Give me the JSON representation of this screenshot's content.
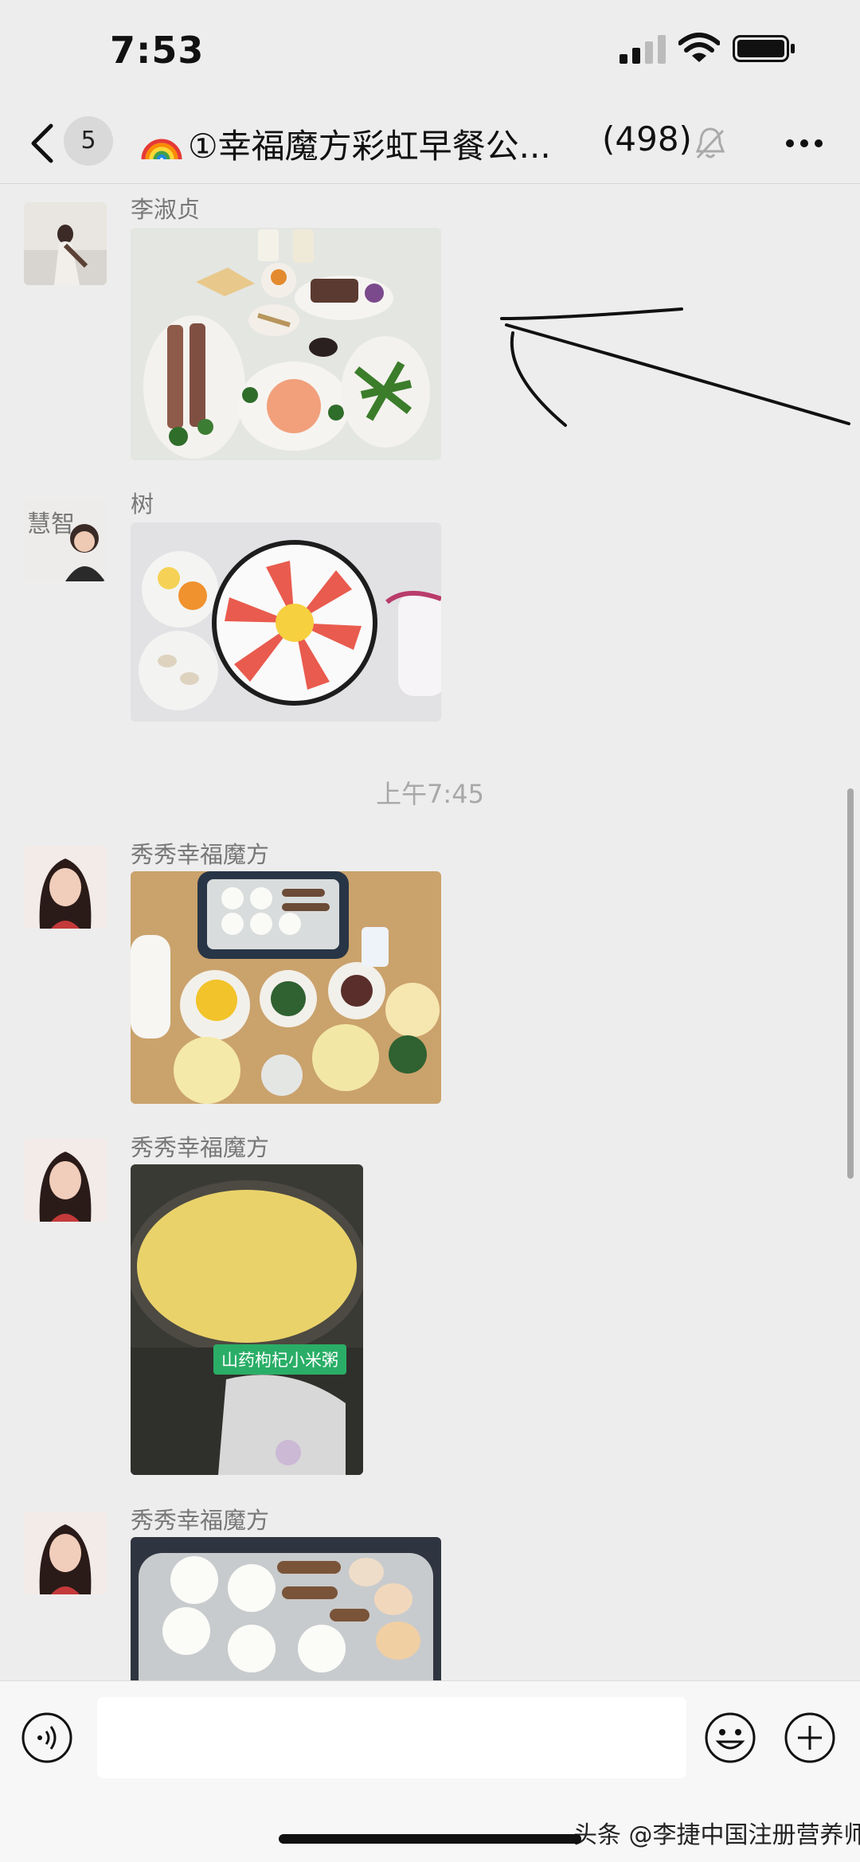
{
  "status_bar": {
    "time": "7:53"
  },
  "header": {
    "unread_count": "5",
    "group_title": "①幸福魔方彩虹早餐公...",
    "member_count": "(498)"
  },
  "messages": [
    {
      "sender": "李淑贞"
    },
    {
      "sender": "树"
    },
    {
      "sender": "秀秀幸福魔方"
    },
    {
      "sender": "秀秀幸福魔方",
      "photo_caption": "山药枸杞小米粥"
    },
    {
      "sender": "秀秀幸福魔方"
    }
  ],
  "timestamp": "上午7:45",
  "input": {
    "placeholder": ""
  },
  "watermark": "头条 @李捷中国注册营养师",
  "colors": {
    "background": "#ededed",
    "input_bar": "#f7f7f7",
    "caption_green": "#2aae67"
  },
  "icons": [
    "back-icon",
    "mute-bell-icon",
    "more-icon",
    "voice-icon",
    "emoji-icon",
    "plus-icon"
  ]
}
